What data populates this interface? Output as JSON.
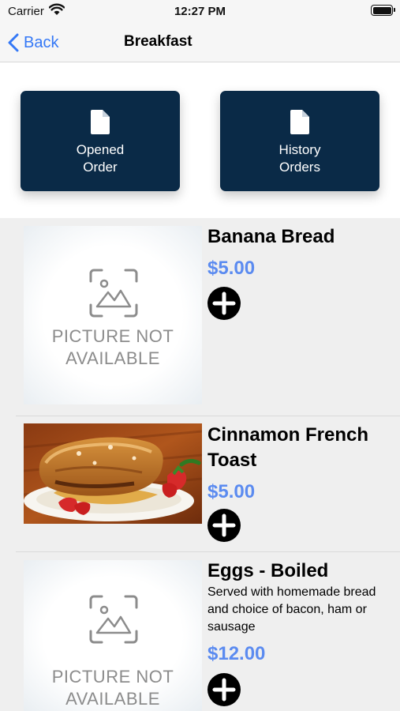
{
  "status_bar": {
    "carrier": "Carrier",
    "time": "12:27 PM"
  },
  "nav": {
    "back_label": "Back",
    "title": "Breakfast"
  },
  "actions": {
    "opened_order": "Opened\nOrder",
    "history_orders": "History\nOrders"
  },
  "placeholder_text": "PICTURE NOT\nAVAILABLE",
  "menu_items": [
    {
      "name": "Banana Bread",
      "price": "$5.00",
      "description": "",
      "image": "placeholder"
    },
    {
      "name": "Cinnamon French Toast",
      "price": "$5.00",
      "description": "",
      "image": "french-toast-photo"
    },
    {
      "name": "Eggs - Boiled",
      "price": "$12.00",
      "description": "Served with homemade bread and choice of bacon, ham or sausage",
      "image": "placeholder"
    }
  ],
  "colors": {
    "accent": "#3478f6",
    "button_bg": "#0a2a47",
    "price": "#5b8bf0",
    "list_bg": "#efefef"
  }
}
